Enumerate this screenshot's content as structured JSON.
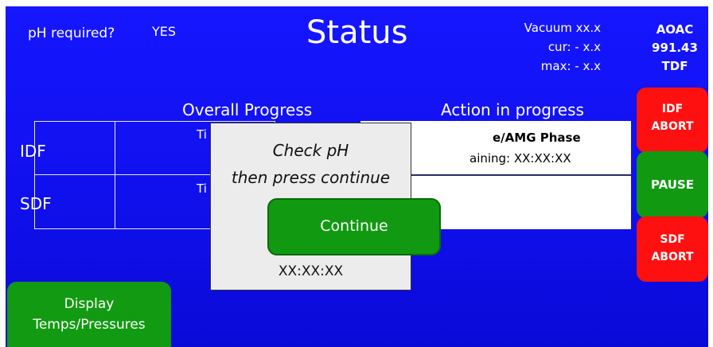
{
  "header": {
    "ph_required_label": "pH required?",
    "ph_required_value": "YES",
    "title": "Status",
    "vacuum_line": "Vacuum  xx.x",
    "cur_line": "cur:  - x.x",
    "max_line": "max:  - x.x",
    "method_line1": "AOAC",
    "method_line2": "991.43",
    "method_line3": "TDF"
  },
  "sections": {
    "overall_progress": "Overall Progress",
    "action_in_progress": "Action in progress"
  },
  "rows": {
    "idf_label": "IDF",
    "sdf_label": "SDF",
    "idf_time_fragment": "Ti",
    "sdf_time_fragment": "Ti"
  },
  "action": {
    "phase_text": "e/AMG Phase",
    "remaining_text": "aining: XX:XX:XX"
  },
  "buttons": {
    "idf_abort_line1": "IDF",
    "idf_abort_line2": "ABORT",
    "pause": "PAUSE",
    "sdf_abort_line1": "SDF",
    "sdf_abort_line2": "ABORT",
    "display_line1": "Display",
    "display_line2": "Temps/Pressures"
  },
  "modal": {
    "message_line1": "Check pH",
    "message_line2": "then press continue",
    "continue_label": "Continue",
    "timer": "XX:XX:XX"
  },
  "colors": {
    "background": "#1414f5",
    "abort": "#ff1010",
    "go": "#119a11"
  }
}
